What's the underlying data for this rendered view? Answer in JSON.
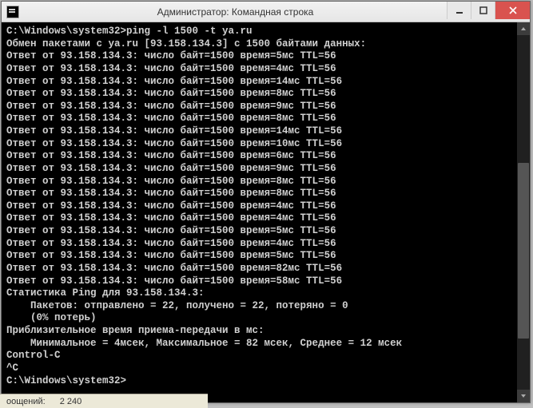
{
  "titlebar": {
    "icon_label": "cmd-icon",
    "title": "Администратор: Командная строка"
  },
  "controls": {
    "minimize_tip": "Свернуть",
    "maximize_tip": "Развернуть",
    "close_tip": "Закрыть"
  },
  "console": {
    "prompt1": "C:\\Windows\\system32>",
    "command": "ping -l 1500 -t ya.ru",
    "header": "Обмен пакетами с ya.ru [93.158.134.3] с 1500 байтами данных:",
    "ip": "93.158.134.3",
    "bytes": 1500,
    "ttl": 56,
    "replies": [
      {
        "time": "5мс"
      },
      {
        "time": "4мс"
      },
      {
        "time": "14мс"
      },
      {
        "time": "8мс"
      },
      {
        "time": "9мс"
      },
      {
        "time": "8мс"
      },
      {
        "time": "14мс"
      },
      {
        "time": "10мс"
      },
      {
        "time": "6мс"
      },
      {
        "time": "9мс"
      },
      {
        "time": "8мс"
      },
      {
        "time": "8мс"
      },
      {
        "time": "4мс"
      },
      {
        "time": "4мс"
      },
      {
        "time": "5мс"
      },
      {
        "time": "4мс"
      },
      {
        "time": "5мс"
      },
      {
        "time": "82мс"
      },
      {
        "time": "58мс"
      }
    ],
    "stats_header": "Статистика Ping для 93.158.134.3:",
    "stats_packets": "    Пакетов: отправлено = 22, получено = 22, потеряно = 0",
    "stats_loss": "    (0% потерь)",
    "rtt_header": "Приблизительное время приема-передачи в мс:",
    "rtt_line": "    Минимальное = 4мсек, Максимальное = 82 мсек, Среднее = 12 мсек",
    "ctrl_c": "Control-C",
    "caret_c": "^C",
    "prompt2": "C:\\Windows\\system32>"
  },
  "status_fragment": {
    "label": "оощений:",
    "count": "2 240"
  }
}
